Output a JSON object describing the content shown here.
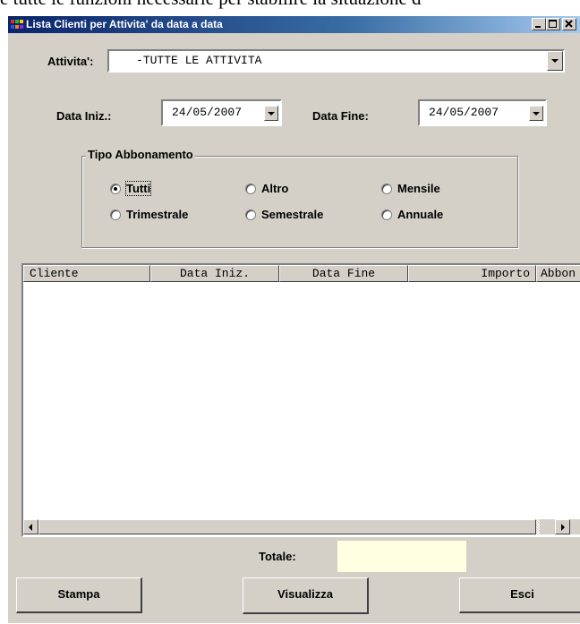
{
  "background_text": "e tutte le funzioni necessarie per stabilire la situazione d",
  "window": {
    "title": "Lista Clienti per Attivita' da data a data",
    "minimize": "_",
    "maximize": "□",
    "close": "×"
  },
  "attivita": {
    "label": "Attivita':",
    "value": "-TUTTE LE ATTIVITA"
  },
  "data_iniz": {
    "label": "Data Iniz.:",
    "value": "24/05/2007"
  },
  "data_fine": {
    "label": "Data Fine:",
    "value": "24/05/2007"
  },
  "tipo_abbonamento": {
    "legend": "Tipo Abbonamento",
    "options": [
      {
        "label": "Tutti",
        "selected": true
      },
      {
        "label": "Altro",
        "selected": false
      },
      {
        "label": "Mensile",
        "selected": false
      },
      {
        "label": "Trimestrale",
        "selected": false
      },
      {
        "label": "Semestrale",
        "selected": false
      },
      {
        "label": "Annuale",
        "selected": false
      }
    ]
  },
  "table": {
    "columns": [
      "Cliente",
      "Data Iniz.",
      "Data Fine",
      "Importo",
      "Abbon"
    ],
    "rows": []
  },
  "totale": {
    "label": "Totale:",
    "value": ""
  },
  "buttons": {
    "stampa": "Stampa",
    "visualizza": "Visualizza",
    "esci": "Esci"
  },
  "colors": {
    "titlebar_start": "#0a246a",
    "titlebar_end": "#a6caf0",
    "face": "#d4d0c8",
    "totale_bg": "#ffffe1"
  }
}
